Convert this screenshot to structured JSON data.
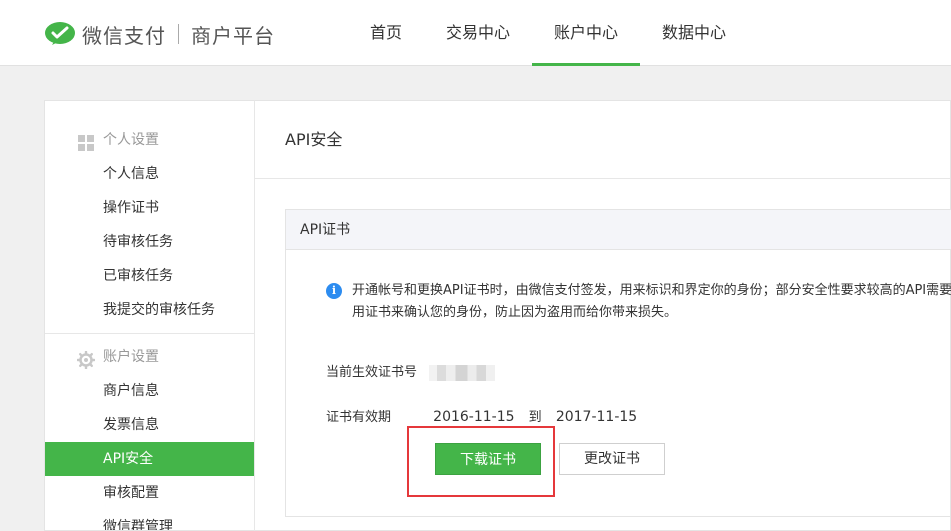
{
  "header": {
    "brand": "微信支付",
    "platform": "商户平台",
    "nav": [
      {
        "label": "首页"
      },
      {
        "label": "交易中心"
      },
      {
        "label": "账户中心"
      },
      {
        "label": "数据中心"
      }
    ],
    "active_nav": "账户中心"
  },
  "sidebar": {
    "groups": [
      {
        "title": "个人设置",
        "icon": "grid-icon",
        "items": [
          "个人信息",
          "操作证书",
          "待审核任务",
          "已审核任务",
          "我提交的审核任务"
        ]
      },
      {
        "title": "账户设置",
        "icon": "gear-icon",
        "items": [
          "商户信息",
          "发票信息",
          "API安全",
          "审核配置",
          "微信群管理"
        ]
      }
    ],
    "active_item": "API安全"
  },
  "main": {
    "title": "API安全",
    "panel": {
      "heading": "API证书",
      "notice": "开通帐号和更换API证书时，由微信支付签发，用来标识和界定你的身份；部分安全性要求较高的API需要使用证书来确认您的身份，防止因为盗用而给你带来损失。",
      "serial_label": "当前生效证书号",
      "validity_label": "证书有效期",
      "valid_from": "2016-11-15",
      "valid_to_word": "到",
      "valid_to": "2017-11-15",
      "download_button": "下载证书",
      "change_button": "更改证书"
    }
  },
  "colors": {
    "brand_green": "#44b549",
    "highlight_red": "#e5383b",
    "info_blue": "#2d8cf0"
  }
}
